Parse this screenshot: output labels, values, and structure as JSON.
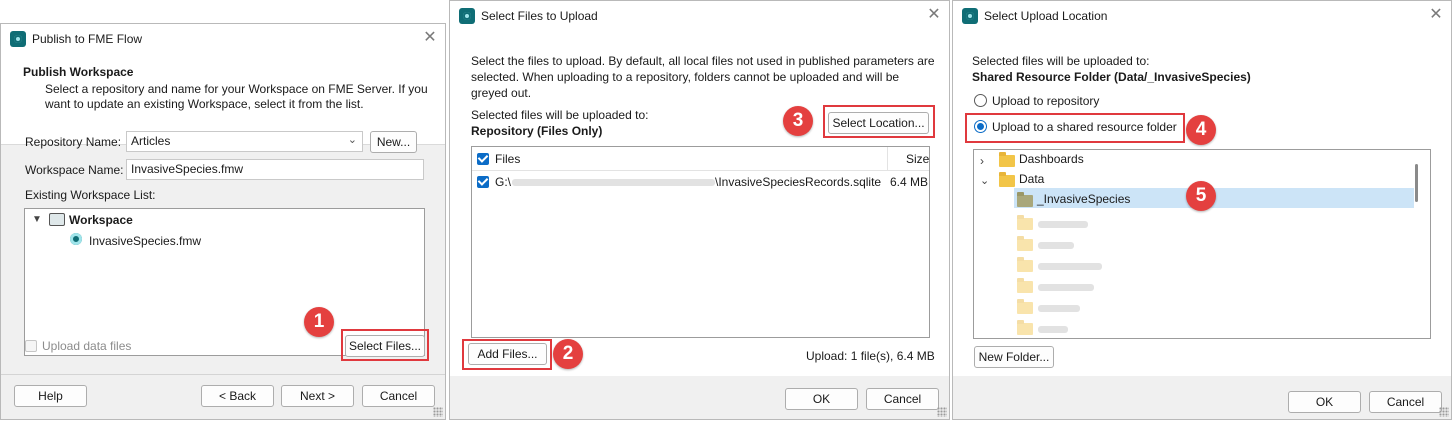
{
  "dialog1": {
    "title": "Publish to FME Flow",
    "heading": "Publish Workspace",
    "description_line1": "Select a repository and name for your Workspace on FME Server. If you",
    "description_line2": "want to update an existing Workspace, select it from the list.",
    "repository_label": "Repository Name:",
    "repository_value": "Articles",
    "new_button": "New...",
    "workspace_label": "Workspace Name:",
    "workspace_value": "InvasiveSpecies.fmw",
    "existing_label": "Existing Workspace List:",
    "tree_root": "Workspace",
    "tree_child": "InvasiveSpecies.fmw",
    "upload_data_files": "Upload data files",
    "select_files_button": "Select Files...",
    "help_button": "Help",
    "back_button": "< Back",
    "next_button": "Next >",
    "cancel_button": "Cancel"
  },
  "dialog2": {
    "title": "Select Files to Upload",
    "intro_line1": "Select the files to upload. By default, all local files not used in published parameters are",
    "intro_line2": "selected. When uploading to a repository, folders cannot be uploaded and will be",
    "intro_line3": "greyed out.",
    "upload_to_label": "Selected files will be uploaded to:",
    "upload_to_value": "Repository (Files Only)",
    "select_location_button": "Select Location...",
    "columns": {
      "files": "Files",
      "size": "Size"
    },
    "file_row": {
      "path_prefix": "G:\\",
      "file_name": "\\InvasiveSpeciesRecords.sqlite",
      "size": "6.4 MB"
    },
    "add_files_button": "Add Files...",
    "upload_summary": "Upload: 1 file(s), 6.4 MB",
    "ok_button": "OK",
    "cancel_button": "Cancel"
  },
  "dialog3": {
    "title": "Select Upload Location",
    "info_line1": "Selected files will be uploaded to:",
    "info_line2": "Shared Resource Folder (Data/_InvasiveSpecies)",
    "radio_repository": "Upload to repository",
    "radio_shared": "Upload to a shared resource folder",
    "tree": {
      "dashboards": "Dashboards",
      "data": "Data",
      "selected": "_InvasiveSpecies"
    },
    "new_folder_button": "New Folder...",
    "ok_button": "OK",
    "cancel_button": "Cancel"
  },
  "badges": [
    "1",
    "2",
    "3",
    "4",
    "5"
  ],
  "colors": {
    "highlight": "#e0393e",
    "badge": "#e4403f",
    "checkbox": "#0b6cc7",
    "folder": "#f2c548",
    "selection": "#cce4f7"
  }
}
